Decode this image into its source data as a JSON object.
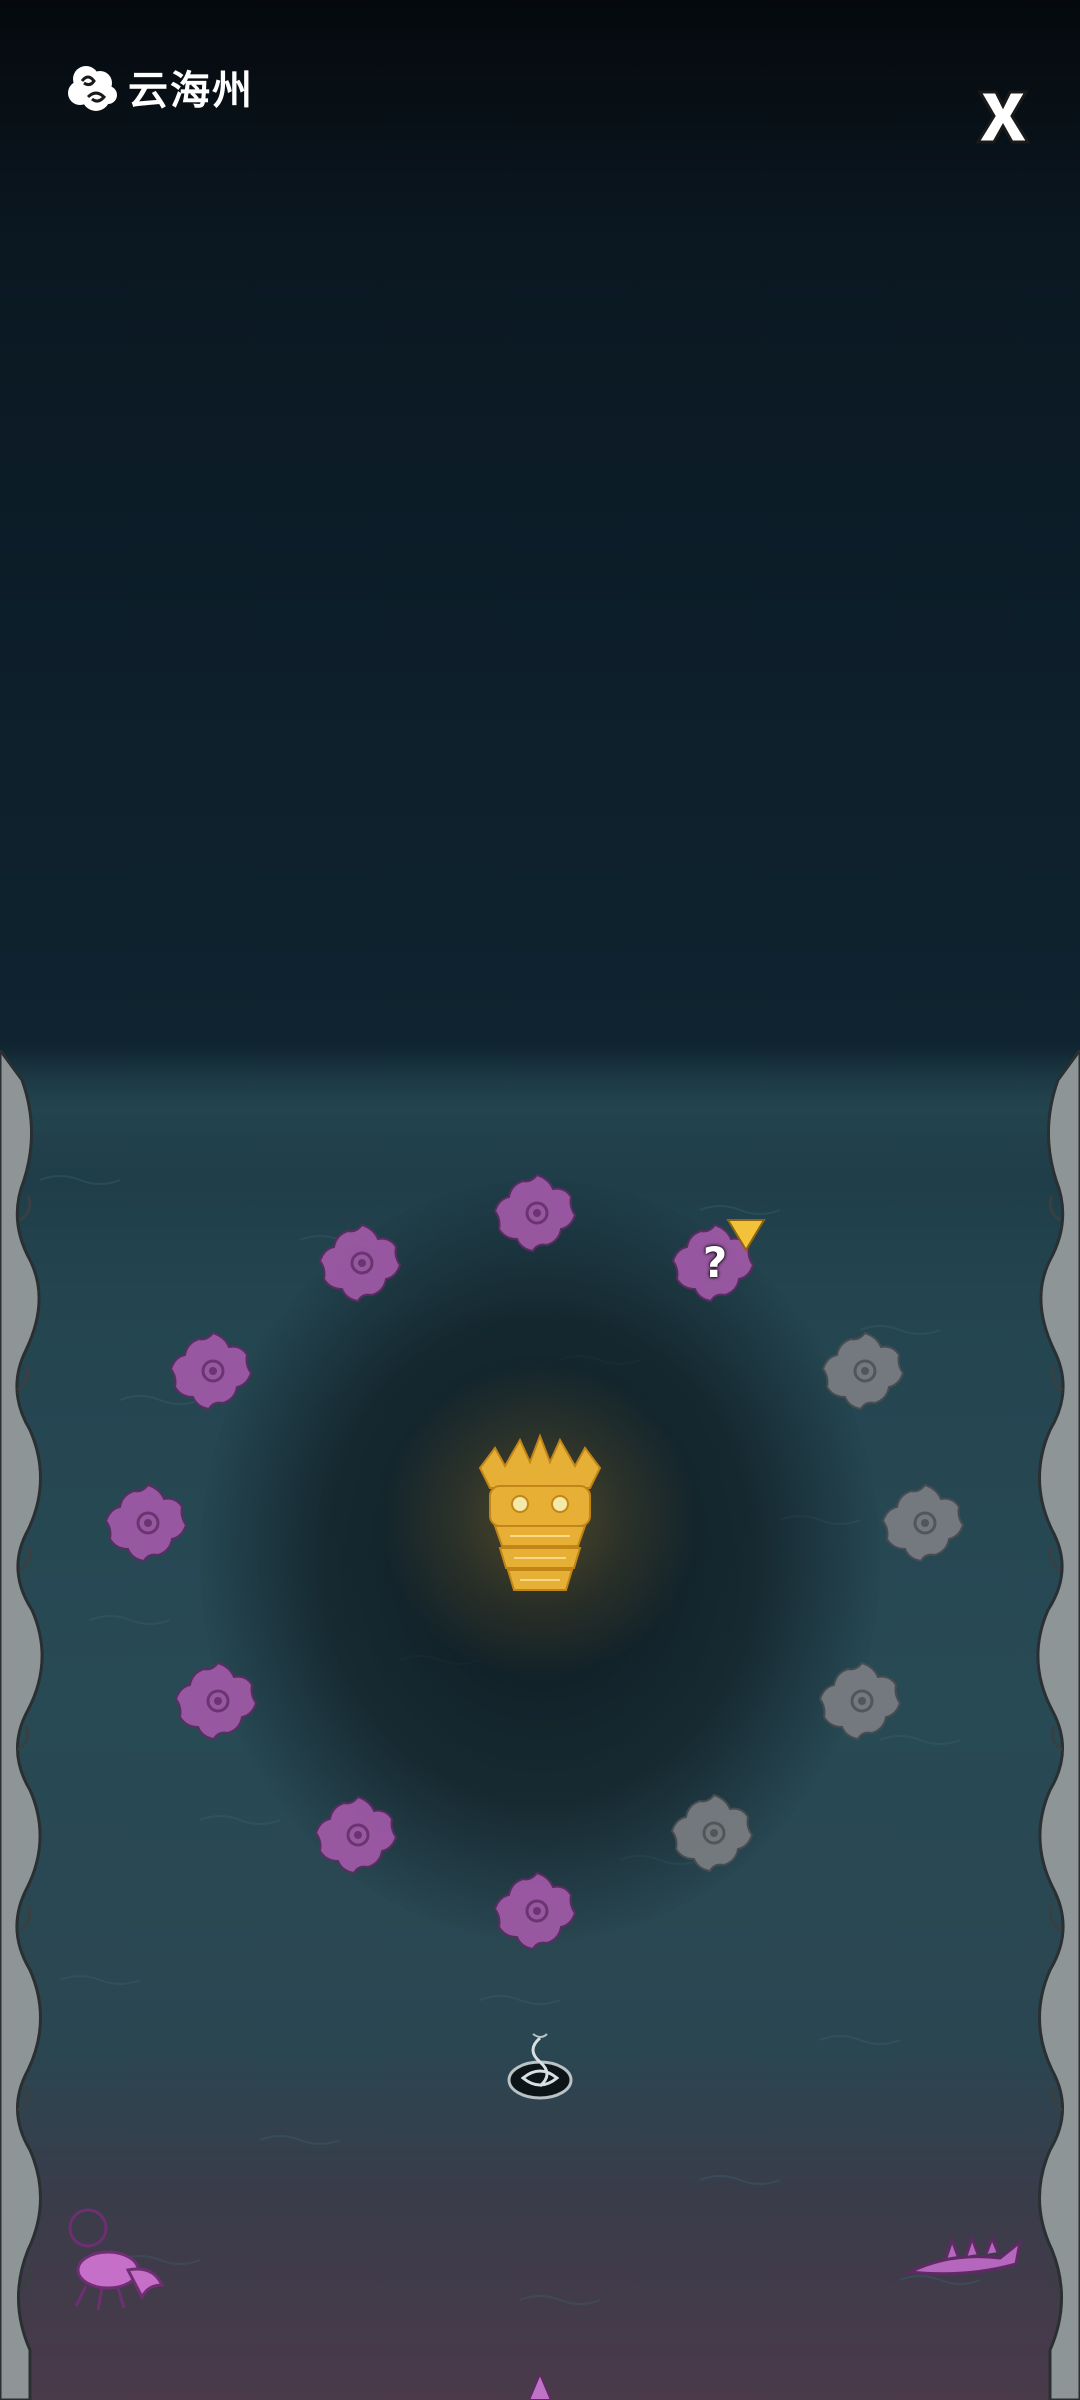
{
  "header": {
    "title": "云海州"
  },
  "colors": {
    "visited_node": "#a25aa8",
    "locked_node": "#7a7e82",
    "boss": "#f0b636",
    "pointer": "#f2c23a"
  },
  "icons": {
    "title_icon": "cloud-icon",
    "close": "close-icon",
    "portal": "portal-icon",
    "unknown": "question-mark"
  },
  "map": {
    "nodes": [
      {
        "state": "visited"
      },
      {
        "state": "unknown",
        "label": "?"
      },
      {
        "state": "locked"
      },
      {
        "state": "locked"
      },
      {
        "state": "locked"
      },
      {
        "state": "locked"
      },
      {
        "state": "visited"
      },
      {
        "state": "visited"
      },
      {
        "state": "visited"
      },
      {
        "state": "visited"
      },
      {
        "state": "visited"
      },
      {
        "state": "visited"
      }
    ]
  }
}
